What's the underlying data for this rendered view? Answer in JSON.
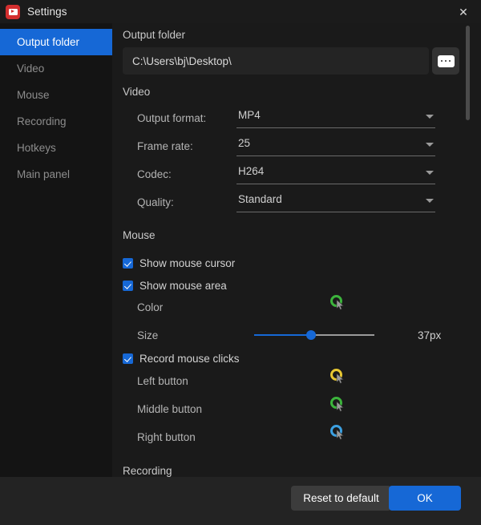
{
  "titlebar": {
    "app_icon": "video-camera-icon",
    "title": "Settings",
    "close_label": "✕"
  },
  "sidebar": {
    "items": [
      {
        "label": "Output folder",
        "active": true
      },
      {
        "label": "Video",
        "active": false
      },
      {
        "label": "Mouse",
        "active": false
      },
      {
        "label": "Recording",
        "active": false
      },
      {
        "label": "Hotkeys",
        "active": false
      },
      {
        "label": "Main panel",
        "active": false
      }
    ]
  },
  "main": {
    "output_folder": {
      "heading": "Output folder",
      "path_value": "C:\\Users\\bj\\Desktop\\",
      "browse_label": "•••"
    },
    "video": {
      "heading": "Video",
      "fields": [
        {
          "label": "Output format:",
          "value": "MP4"
        },
        {
          "label": "Frame rate:",
          "value": "25"
        },
        {
          "label": "Codec:",
          "value": "H264"
        },
        {
          "label": "Quality:",
          "value": "Standard"
        }
      ]
    },
    "mouse": {
      "heading": "Mouse",
      "show_cursor": {
        "label": "Show mouse cursor",
        "checked": true
      },
      "show_area": {
        "label": "Show mouse area",
        "checked": true
      },
      "color": {
        "label": "Color",
        "color": "#3cb43c"
      },
      "size": {
        "label": "Size",
        "value": "37px",
        "percent": 47
      },
      "record_clicks": {
        "label": "Record mouse clicks",
        "checked": true
      },
      "buttons": [
        {
          "label": "Left button",
          "color": "#e8c832"
        },
        {
          "label": "Middle button",
          "color": "#3cb43c"
        },
        {
          "label": "Right button",
          "color": "#3ca0e0"
        }
      ]
    },
    "recording": {
      "heading": "Recording"
    }
  },
  "footer": {
    "reset_label": "Reset to default",
    "ok_label": "OK"
  },
  "colors": {
    "accent": "#1668d6",
    "window_bg": "#141414",
    "content_bg": "#1a1a1a",
    "footer_bg": "#232323"
  }
}
